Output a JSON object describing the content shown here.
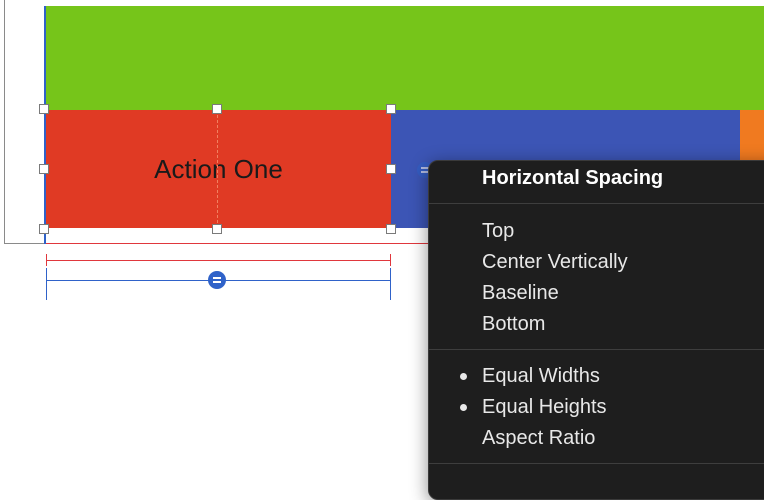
{
  "colors": {
    "green_view": "#76c51a",
    "red_view": "#e03a24",
    "blue_view": "#3c55b5",
    "orange_view": "#f07a20",
    "constraint_red": "#e0373d",
    "constraint_blue": "#2f62c9"
  },
  "canvas": {
    "red_view_label": "Action One"
  },
  "context_menu": {
    "header": "Horizontal Spacing",
    "groups": [
      [
        {
          "label": "Top",
          "checked": false
        },
        {
          "label": "Center Vertically",
          "checked": false
        },
        {
          "label": "Baseline",
          "checked": false
        },
        {
          "label": "Bottom",
          "checked": false
        }
      ],
      [
        {
          "label": "Equal Widths",
          "checked": true
        },
        {
          "label": "Equal Heights",
          "checked": true
        },
        {
          "label": "Aspect Ratio",
          "checked": false
        }
      ]
    ]
  }
}
